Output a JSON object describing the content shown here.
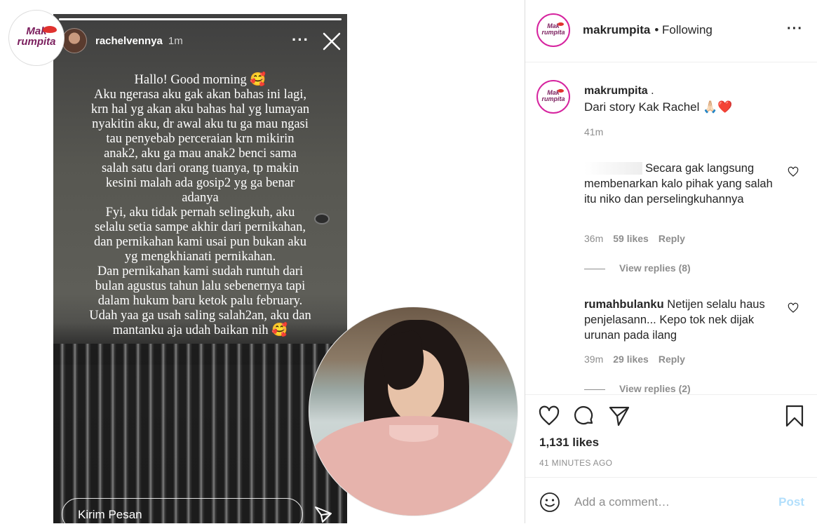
{
  "media": {
    "logo": {
      "line1": "Mak",
      "line2": "rumpita"
    },
    "story": {
      "progress": 1.0,
      "username": "rachelvennya",
      "time": "1m",
      "more": "···",
      "text": "Hallo! Good morning 🥰\nAku ngerasa aku gak akan bahas ini lagi,\nkrn hal yg akan aku bahas hal yg lumayan\nnyakitin aku, dr awal aku tu ga mau ngasi\ntau penyebab perceraian krn mikirin\nanak2, aku ga mau anak2 benci sama\nsalah satu dari orang tuanya, tp makin\nkesini malah ada gosip2 yg ga benar\nadanya\nFyi, aku tidak pernah selingkuh, aku\nselalu setia sampe akhir dari pernikahan,\ndan pernikahan kami usai pun bukan aku\nyg mengkhianati pernikahan.\nDan pernikahan kami sudah runtuh dari\nbulan agustus tahun lalu sebenernya tapi\ndalam hukum baru ketok palu february.\nUdah yaa ga usah saling salah2an, aku dan\nmantanku aja udah baikan nih 🥰",
      "reply_placeholder": "Kirim Pesan"
    }
  },
  "header": {
    "username": "makrumpita",
    "follow_status": "• Following",
    "more": "···"
  },
  "caption": {
    "username": "makrumpita",
    "suffix": ".",
    "text": "Dari story Kak Rachel 🙏🏻❤️",
    "time": "41m"
  },
  "comments": [
    {
      "text": "Secara gak langsung membenarkan kalo pihak yang salah itu niko dan perselingkuhannya",
      "time": "36m",
      "likes": "59 likes",
      "reply": "Reply",
      "view_replies": "View replies (8)"
    },
    {
      "username": "rumahbulanku",
      "text": "Netijen selalu haus penjelasann... Kepo tok nek dijak urunan pada ilang",
      "time": "39m",
      "likes": "29 likes",
      "reply": "Reply",
      "view_replies": "View replies (2)"
    }
  ],
  "actions": {
    "likes": "1,131 likes",
    "time_ago": "41 MINUTES AGO"
  },
  "add_comment": {
    "placeholder": "Add a comment…",
    "post_label": "Post"
  },
  "icons": [
    "close-icon",
    "more-icon",
    "send-icon",
    "heart-icon",
    "comment-icon",
    "share-icon",
    "bookmark-icon",
    "emoji-icon"
  ],
  "colors": {
    "link_blue_disabled": "#b2dffc",
    "text": "#262626",
    "muted": "#8e8e8e",
    "avatar_ring": "#d6249f"
  }
}
